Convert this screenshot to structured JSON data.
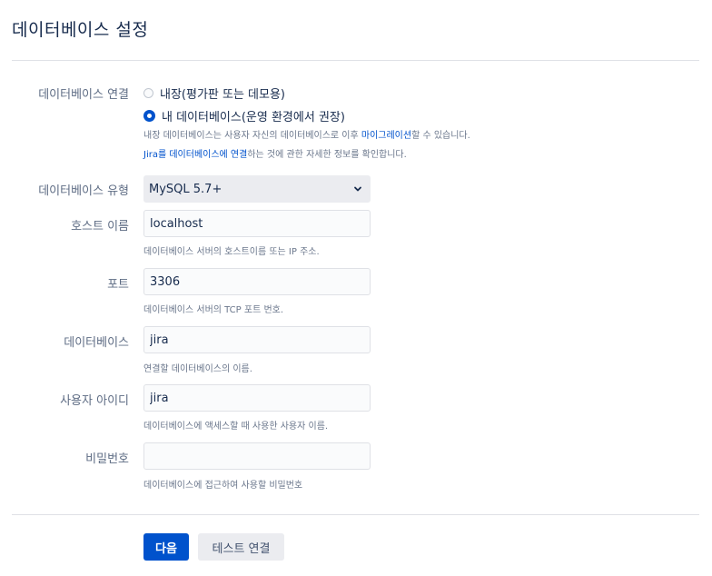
{
  "page": {
    "title": "데이터베이스 설정"
  },
  "connection": {
    "label": "데이터베이스 연결",
    "options": [
      {
        "label": "내장(평가판 또는 데모용)",
        "checked": false
      },
      {
        "label": "내 데이터베이스(운영 환경에서 권장)",
        "checked": true
      }
    ],
    "help_line1_pre": "내장 데이터베이스는 사용자 자신의 데이터베이스로 이후 ",
    "help_line1_link": "마이그레이션",
    "help_line1_post": "할 수 있습니다.",
    "help_line2_link": "Jira를 데이터베이스에 연결",
    "help_line2_post": "하는 것에 관한 자세한 정보를 확인합니다."
  },
  "db_type": {
    "label": "데이터베이스 유형",
    "value": "MySQL 5.7+"
  },
  "host": {
    "label": "호스트 이름",
    "value": "localhost",
    "help": "데이터베이스 서버의 호스트이름 또는 IP 주소."
  },
  "port": {
    "label": "포트",
    "value": "3306",
    "help": "데이터베이스 서버의 TCP 포트 번호."
  },
  "database": {
    "label": "데이터베이스",
    "value": "jira",
    "help": "연결할 데이터베이스의 이름."
  },
  "username": {
    "label": "사용자 아이디",
    "value": "jira",
    "help": "데이터베이스에 액세스할 때 사용한 사용자 이름."
  },
  "password": {
    "label": "비밀번호",
    "value": "",
    "help": "데이터베이스에 접근하여 사용할 비밀번호"
  },
  "buttons": {
    "next": "다음",
    "test": "테스트 연결"
  },
  "colors": {
    "accent": "#0052cc",
    "text": "#172b4d",
    "muted": "#6b778c"
  }
}
